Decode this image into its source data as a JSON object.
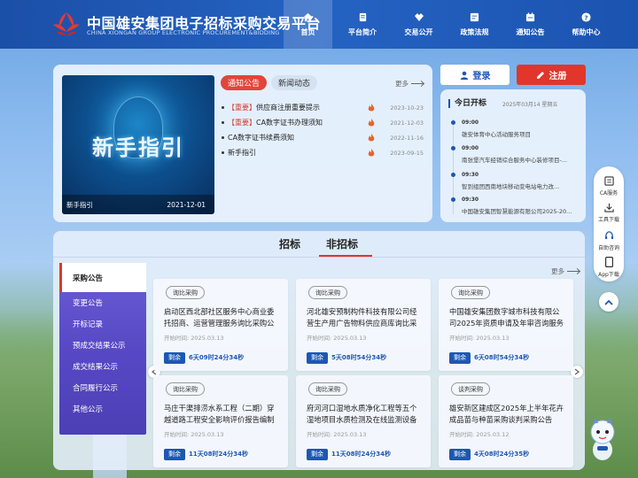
{
  "header": {
    "title": "中国雄安集团电子招标采购交易平台",
    "subtitle": "CHINA XIONGAN GROUP ELECTRONIC PROCUREMENT&BIDDING",
    "nav": [
      {
        "label": "首页",
        "icon": "home-icon"
      },
      {
        "label": "平台简介",
        "icon": "document-icon"
      },
      {
        "label": "交易公开",
        "icon": "handshake-icon"
      },
      {
        "label": "政策法规",
        "icon": "law-icon"
      },
      {
        "label": "通知公告",
        "icon": "notice-icon"
      },
      {
        "label": "帮助中心",
        "icon": "help-icon"
      }
    ]
  },
  "banner": {
    "big_text": "新手指引",
    "caption": "新手指引",
    "date": "2021-12-01"
  },
  "announcements": {
    "tabs": [
      "通知公告",
      "新闻动态"
    ],
    "more": "更多",
    "items": [
      {
        "tag": "【重要】",
        "text": "供应商注册重要提示",
        "date": "2023-10-23"
      },
      {
        "tag": "【重要】",
        "text": "CA数字证书办理须知",
        "date": "2021-12-03"
      },
      {
        "tag": "",
        "text": "CA数字证书续费须知",
        "date": "2022-11-16"
      },
      {
        "tag": "",
        "text": "新手指引",
        "date": "2023-09-15"
      }
    ]
  },
  "auth": {
    "login": "登录",
    "register": "注册"
  },
  "today_bid": {
    "heading": "今日开标",
    "date": "2025年03月14 星期五",
    "items": [
      {
        "time": "09:00",
        "name": "雄安体育中心活动服务项目"
      },
      {
        "time": "09:00",
        "name": "南张堡汽车经销综合服务中心装修项目-..."
      },
      {
        "time": "09:30",
        "name": "智到组团西南地块移动变电站电力改..."
      },
      {
        "time": "09:30",
        "name": "中国雄安集团智慧能源有限公司2025-20..."
      }
    ]
  },
  "tools": [
    {
      "label": "CA服务",
      "icon": "ca-service-icon"
    },
    {
      "label": "工具下载",
      "icon": "download-icon"
    },
    {
      "label": "自助咨询",
      "icon": "headset-icon"
    },
    {
      "label": "App下载",
      "icon": "phone-icon"
    }
  ],
  "bidding": {
    "tabs": [
      "招标",
      "非招标"
    ],
    "active_tab": "非招标",
    "more": "更多",
    "side_menu": [
      "采购公告",
      "变更公告",
      "开标记录",
      "预成交结果公示",
      "成交结果公示",
      "合同履行公示",
      "其他公示"
    ],
    "start_label": "开始时间:",
    "remain_label": "剩余",
    "projects": [
      {
        "type": "询比采购",
        "title": "启动区西北部社区服务中心商业委托招商、运营管理服务询比采购公告",
        "start": "2025.03.13",
        "remain": "6天09时24分34秒"
      },
      {
        "type": "询比采购",
        "title": "河北雄安预制构件科技有限公司经营生产用广告物料供应商库询比采购...",
        "start": "2025.03.13",
        "remain": "5天08时54分34秒"
      },
      {
        "type": "询比采购",
        "title": "中国雄安集团数字城市科技有限公司2025年资质申请及年审咨询服务询...",
        "start": "2025.03.13",
        "remain": "6天08时54分34秒"
      },
      {
        "type": "询比采购",
        "title": "马庄干渠排涝水系工程（二期）穿越道路工程安全影响评价报告编制询...",
        "start": "2025.03.13",
        "remain": "11天08时24分34秒"
      },
      {
        "type": "询比采购",
        "title": "府河河口湿地水质净化工程等五个湿地项目水质检测及在线监测设备维...",
        "start": "2025.03.13",
        "remain": "11天08时24分34秒"
      },
      {
        "type": "谈判采购",
        "title": "雄安新区建成区2025年上半年花卉成品苗与种苗采购谈判采购公告",
        "start": "2025.03.12",
        "remain": "4天08时24分35秒"
      }
    ]
  },
  "colors": {
    "brand_blue": "#1d57b4",
    "accent_red": "#e1362c",
    "menu_purple": "#5749c5"
  }
}
